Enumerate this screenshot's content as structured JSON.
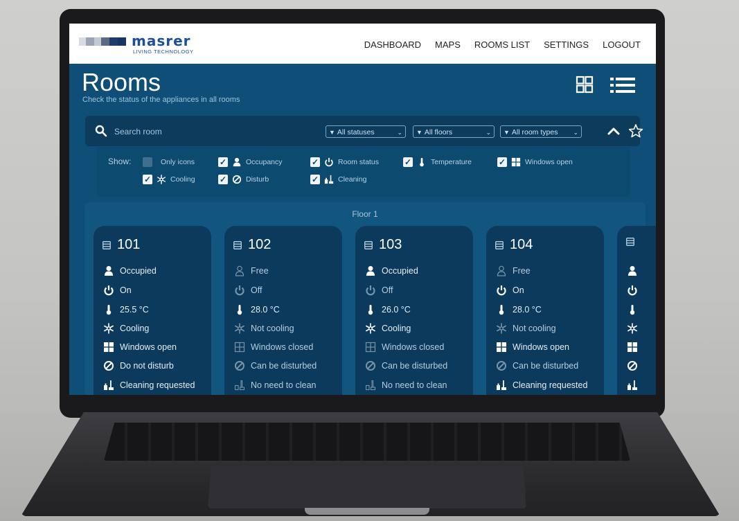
{
  "brand": {
    "name": "masrer",
    "tagline": "LIVING TECHNOLOGY"
  },
  "nav": [
    "DASHBOARD",
    "MAPS",
    "ROOMS LIST",
    "SETTINGS",
    "LOGOUT"
  ],
  "page": {
    "title": "Rooms",
    "subtitle": "Check the status of the appliances in all rooms"
  },
  "search": {
    "placeholder": "Search room"
  },
  "filters": {
    "statuses": "All statuses",
    "floors": "All floors",
    "room_types": "All room types"
  },
  "show": {
    "label": "Show:",
    "options": [
      {
        "label": "Only icons",
        "checked": false
      },
      {
        "label": "Occupancy",
        "checked": true
      },
      {
        "label": "Room status",
        "checked": true
      },
      {
        "label": "Temperature",
        "checked": true
      },
      {
        "label": "Windows open",
        "checked": true
      },
      {
        "label": "Cooling",
        "checked": true
      },
      {
        "label": "Disturb",
        "checked": true
      },
      {
        "label": "Cleaning",
        "checked": true
      }
    ]
  },
  "floor": {
    "label": "Floor 1",
    "rooms": [
      {
        "number": "101",
        "occupancy": "Occupied",
        "status": "On",
        "temperature": "25.5 °C",
        "cooling": "Cooling",
        "windows": "Windows open",
        "disturb": "Do not disturb",
        "cleaning": "Cleaning requested"
      },
      {
        "number": "102",
        "occupancy": "Free",
        "status": "Off",
        "temperature": "28.0 °C",
        "cooling": "Not cooling",
        "windows": "Windows closed",
        "disturb": "Can be disturbed",
        "cleaning": "No need to clean"
      },
      {
        "number": "103",
        "occupancy": "Occupied",
        "status": "Off",
        "temperature": "26.0 °C",
        "cooling": "Cooling",
        "windows": "Windows closed",
        "disturb": "Can be disturbed",
        "cleaning": "No need to clean"
      },
      {
        "number": "104",
        "occupancy": "Free",
        "status": "On",
        "temperature": "28.0 °C",
        "cooling": "Not cooling",
        "windows": "Windows open",
        "disturb": "Can be disturbed",
        "cleaning": "Cleaning requested"
      }
    ]
  },
  "colors": {
    "screen_bg": "#0f4f77",
    "card_bg": "#0b3a5c",
    "panel_bg": "#0c3b5b",
    "brand": "#1d4e9c"
  }
}
